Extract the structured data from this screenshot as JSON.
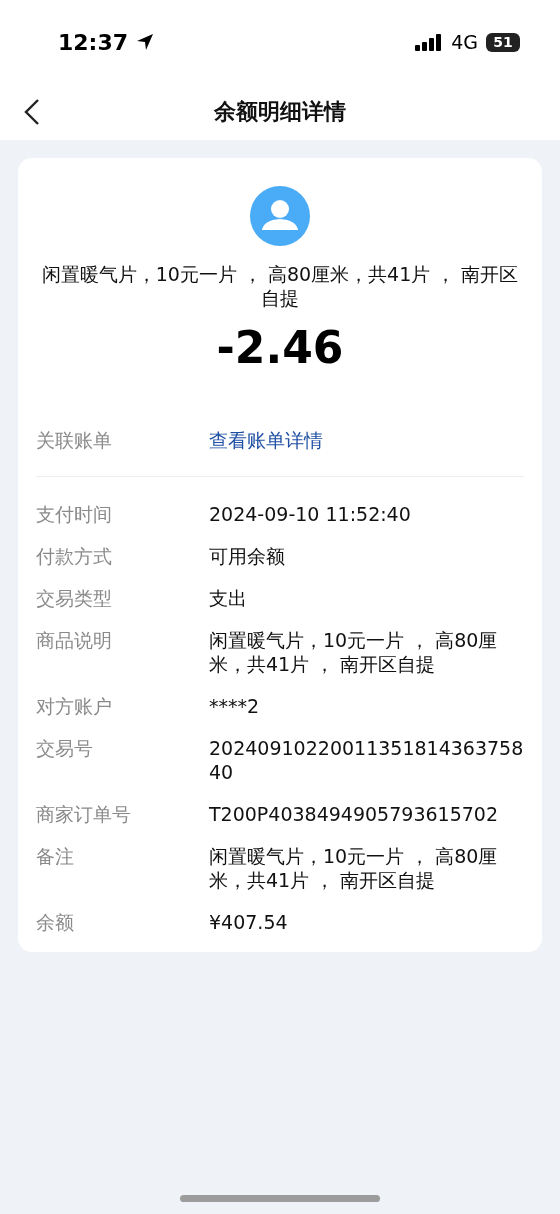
{
  "status_bar": {
    "time": "12:37",
    "network": "4G",
    "battery": "51"
  },
  "nav": {
    "title": "余额明细详情"
  },
  "summary": {
    "description": "闲置暖气片，10元一片 ， 高80厘米，共41片 ， 南开区自提",
    "amount": "-2.46"
  },
  "related": {
    "label": "关联账单",
    "link": "查看账单详情"
  },
  "details": [
    {
      "label": "支付时间",
      "value": "2024-09-10 11:52:40"
    },
    {
      "label": "付款方式",
      "value": "可用余额"
    },
    {
      "label": "交易类型",
      "value": "支出"
    },
    {
      "label": "商品说明",
      "value": "闲置暖气片，10元一片 ， 高80厘米，共41片 ， 南开区自提"
    },
    {
      "label": "对方账户",
      "value": "****2"
    },
    {
      "label": "交易号",
      "value": "2024091022001135181436375840"
    },
    {
      "label": "商家订单号",
      "value": "T200P4038494905793615702"
    },
    {
      "label": "备注",
      "value": "闲置暖气片，10元一片 ， 高80厘米，共41片 ， 南开区自提"
    },
    {
      "label": "余额",
      "value": "¥407.54"
    }
  ]
}
